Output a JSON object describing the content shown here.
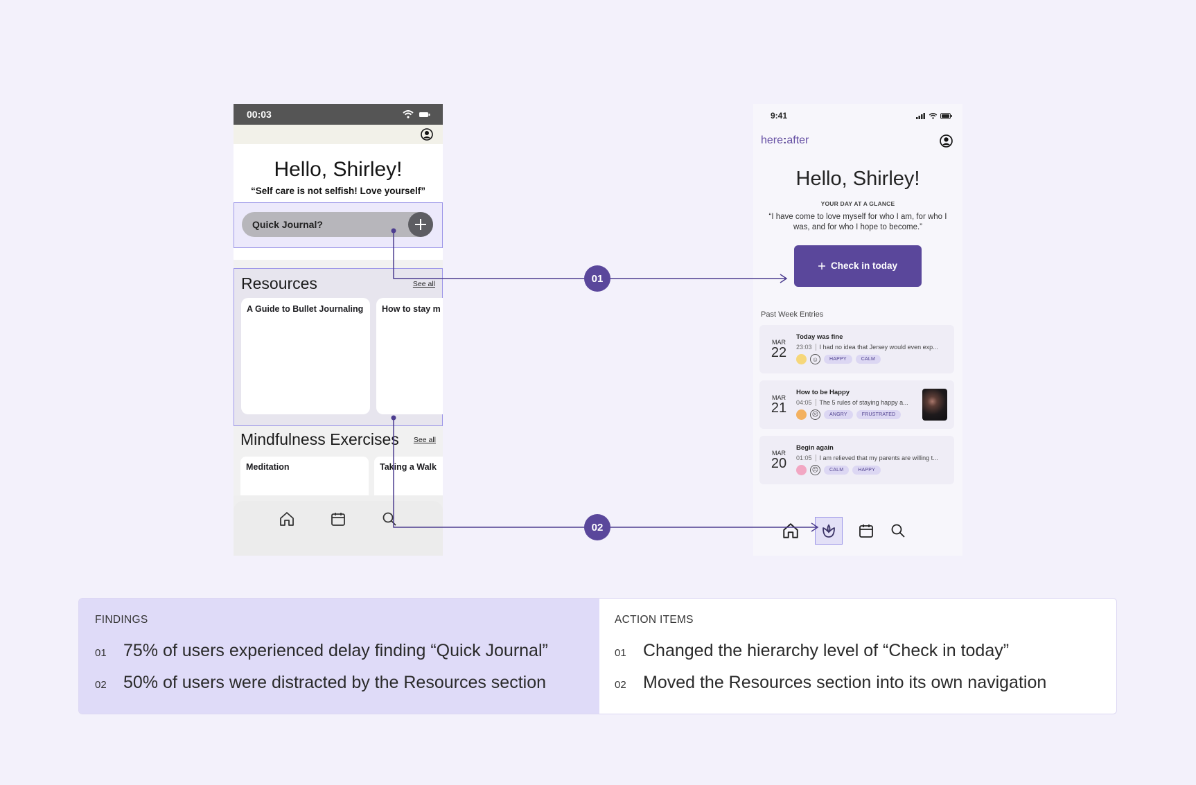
{
  "old_screen": {
    "time": "00:03",
    "greeting": "Hello, Shirley!",
    "quote": "“Self care is not selfish! Love yourself”",
    "quick_journal": "Quick Journal?",
    "resources": {
      "title": "Resources",
      "see_all": "See all",
      "cards": [
        "A Guide to Bullet Journaling",
        "How to stay m"
      ]
    },
    "mindfulness": {
      "title": "Mindfulness Exercises",
      "see_all": "See all",
      "cards": [
        "Meditation",
        "Taking a Walk"
      ]
    },
    "nav": [
      "home-icon",
      "calendar-icon",
      "search-icon"
    ]
  },
  "new_screen": {
    "time": "9:41",
    "brand": {
      "left": "here",
      "sep": ":",
      "right": "after"
    },
    "greeting": "Hello, Shirley!",
    "glance_label": "YOUR DAY AT A GLANCE",
    "quote": "“I have come to love myself for who I am, for who I was, and for who I hope to become.”",
    "checkin_label": "Check in today",
    "past_title": "Past Week Entries",
    "entries": [
      {
        "month": "MAR",
        "day": "22",
        "title": "Today was fine",
        "time": "23:03",
        "excerpt": "I had no idea that Jersey would even exp...",
        "mood_color": "#f6d77a",
        "face": "☺",
        "tags": [
          "HAPPY",
          "CALM"
        ]
      },
      {
        "month": "MAR",
        "day": "21",
        "title": "How to be Happy",
        "time": "04:05",
        "excerpt": "The 5 rules of staying happy a...",
        "mood_color": "#f3b15f",
        "face": "☹",
        "tags": [
          "ANGRY",
          "FRUSTRATED"
        ]
      },
      {
        "month": "MAR",
        "day": "20",
        "title": "Begin again",
        "time": "01:05",
        "excerpt": "I am relieved that my parents are willing t...",
        "mood_color": "#f2a7c3",
        "face": "☹",
        "tags": [
          "CALM",
          "HAPPY"
        ]
      }
    ],
    "nav": [
      "home-icon",
      "lotus-icon",
      "calendar-icon",
      "search-icon"
    ]
  },
  "badges": [
    "01",
    "02"
  ],
  "findings": {
    "title": "FINDINGS",
    "items": [
      {
        "num": "01",
        "text": "75% of users experienced delay finding “Quick Journal”"
      },
      {
        "num": "02",
        "text": "50% of users were distracted by the Resources section"
      }
    ]
  },
  "actions": {
    "title": "ACTION ITEMS",
    "items": [
      {
        "num": "01",
        "text": "Changed the hierarchy level of “Check in today”"
      },
      {
        "num": "02",
        "text": "Moved the Resources section into its own navigation"
      }
    ]
  },
  "colors": {
    "accent": "#5a479b",
    "highlight_border": "#9d97e8",
    "findings_bg": "#dfdbf8",
    "page_bg": "#f3f1fb"
  }
}
